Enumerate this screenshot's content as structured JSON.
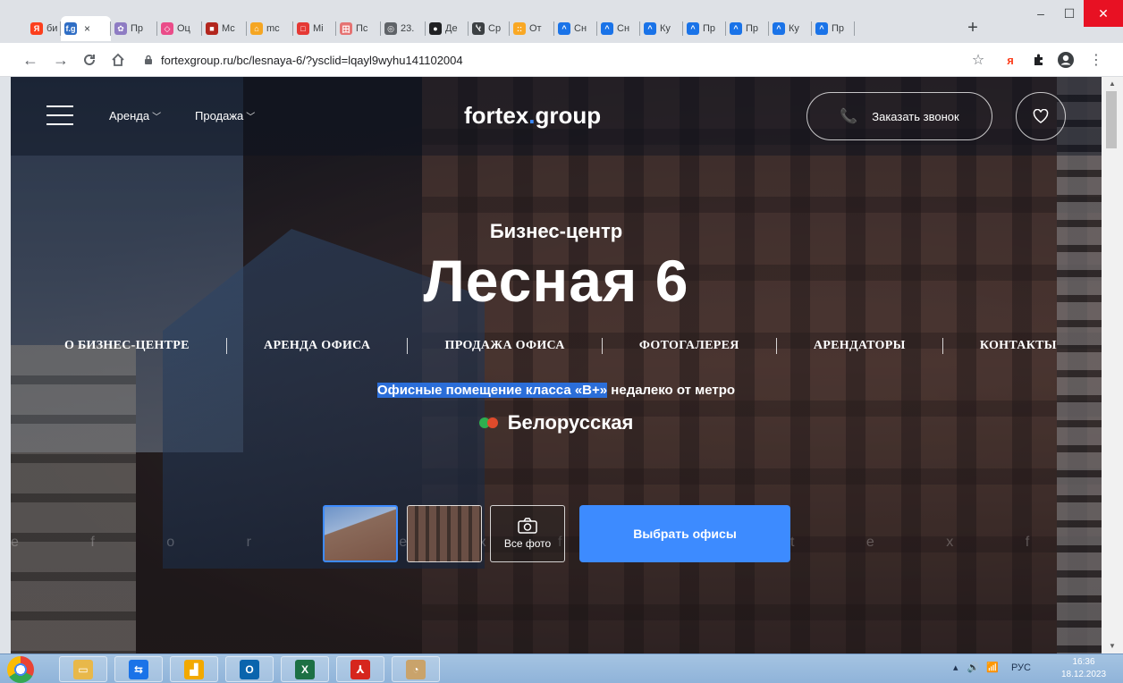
{
  "browser": {
    "tabs": [
      {
        "label": "би",
        "fav_color": "#fc3f1d",
        "fav_char": "Я"
      },
      {
        "label": "",
        "fav_color": "#2f6ec5",
        "fav_char": "f.g",
        "active": true
      },
      {
        "label": "Пр",
        "fav_color": "#8e7cc3",
        "fav_char": "✿"
      },
      {
        "label": "Оц",
        "fav_color": "#ea4c89",
        "fav_char": "◇"
      },
      {
        "label": "Мс",
        "fav_color": "#b3261e",
        "fav_char": "■"
      },
      {
        "label": "mc",
        "fav_color": "#f5a623",
        "fav_char": "⌂"
      },
      {
        "label": "Mi",
        "fav_color": "#e53935",
        "fav_char": "□"
      },
      {
        "label": "Пс",
        "fav_color": "#e57373",
        "fav_char": "田"
      },
      {
        "label": "23.",
        "fav_color": "#5f6368",
        "fav_char": "◎"
      },
      {
        "label": "Де",
        "fav_color": "#202124",
        "fav_char": "●"
      },
      {
        "label": "Ср",
        "fav_color": "#3c4043",
        "fav_char": "ﭏ"
      },
      {
        "label": "От",
        "fav_color": "#f9a825",
        "fav_char": "::"
      },
      {
        "label": "Сн",
        "fav_color": "#1a73e8",
        "fav_char": "^"
      },
      {
        "label": "Сн",
        "fav_color": "#1a73e8",
        "fav_char": "^"
      },
      {
        "label": "Ку",
        "fav_color": "#1a73e8",
        "fav_char": "^"
      },
      {
        "label": "Пр",
        "fav_color": "#1a73e8",
        "fav_char": "^"
      },
      {
        "label": "Пр",
        "fav_color": "#1a73e8",
        "fav_char": "^"
      },
      {
        "label": "Ку",
        "fav_color": "#1a73e8",
        "fav_char": "^"
      },
      {
        "label": "Пр",
        "fav_color": "#1a73e8",
        "fav_char": "^"
      }
    ],
    "tab_close": "×",
    "new_tab": "+",
    "window": {
      "minimize": "–",
      "maximize": "☐",
      "close": "✕"
    },
    "url": "fortexgroup.ru/bc/lesnaya-6/?ysclid=lqayl9wyhu141102004"
  },
  "site": {
    "nav": {
      "rent": "Аренда",
      "sale": "Продажа"
    },
    "logo": {
      "part1": "fortex",
      "dot": ".",
      "part2": "group"
    },
    "call_button": "Заказать звонок",
    "hero": {
      "eyebrow": "Бизнес-центр",
      "title": "Лесная 6",
      "tagline_highlight": "Офисные помещение класса «В+»",
      "tagline_rest": " недалеко от метро",
      "metro": "Белорусская",
      "watermark": "e f o r t e x                       f o r t e x f o r"
    },
    "subnav": [
      "О БИЗНЕС-ЦЕНТРЕ",
      "АРЕНДА ОФИСА",
      "ПРОДАЖА ОФИСА",
      "ФОТОГАЛЕРЕЯ",
      "АРЕНДАТОРЫ",
      "КОНТАКТЫ"
    ],
    "all_photos": "Все фото",
    "select_offices": "Выбрать офисы",
    "accent_color": "#3d8bff"
  },
  "taskbar": {
    "lang": "РУС",
    "time": "16:36",
    "date": "18.12.2023"
  }
}
